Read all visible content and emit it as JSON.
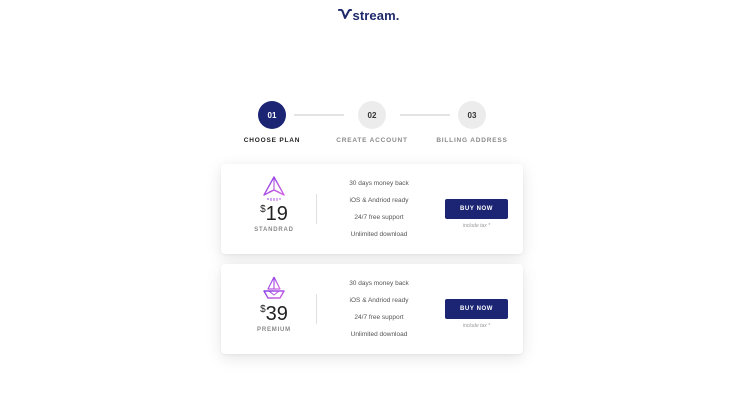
{
  "brand": {
    "name": "stream."
  },
  "steps": [
    {
      "number": "01",
      "label": "CHOOSE PLAN"
    },
    {
      "number": "02",
      "label": "CREATE ACCOUNT"
    },
    {
      "number": "03",
      "label": "BILLING ADDRESS"
    }
  ],
  "plans": [
    {
      "currency": "$",
      "price": "19",
      "name": "STANDRAD",
      "features": [
        "30 days money back",
        "iOS & Andriod ready",
        "24/7 free support",
        "Unlimited download"
      ],
      "button_label": "BUY NOW",
      "tax_note": "include tax *"
    },
    {
      "currency": "$",
      "price": "39",
      "name": "PREMIUM",
      "features": [
        "30 days money back",
        "iOS & Andriod ready",
        "24/7 free support",
        "Unlimited download"
      ],
      "button_label": "BUY NOW",
      "tax_note": "include tax *"
    }
  ],
  "colors": {
    "accent": "#1b2574",
    "icon_gradient_start": "#8a3fe8",
    "icon_gradient_end": "#d266e0"
  },
  "icons": {
    "logo": "v-logo-icon",
    "standard": "paper-plane-icon",
    "premium": "paper-boat-icon"
  }
}
